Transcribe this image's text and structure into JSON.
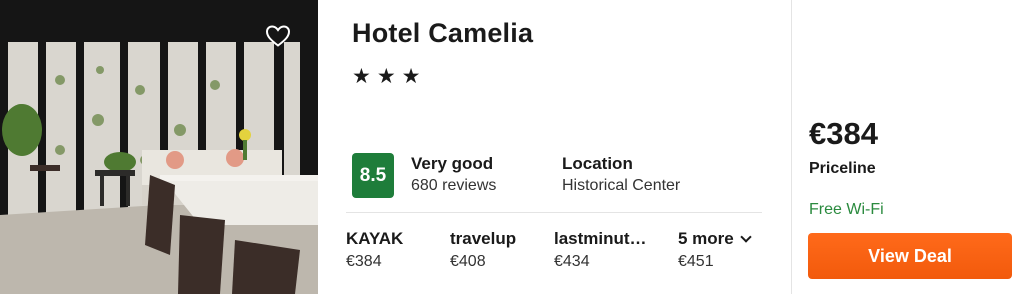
{
  "hotel": {
    "name": "Hotel Camelia",
    "stars_display": "★★★",
    "star_count": 3,
    "favorite_icon": "heart-outline-icon"
  },
  "rating": {
    "score": "8.5",
    "label": "Very good",
    "reviews": "680 reviews",
    "badge_color": "#1e7d3a"
  },
  "location": {
    "label": "Location",
    "value": "Historical Center"
  },
  "providers": [
    {
      "name": "KAYAK",
      "price": "€384"
    },
    {
      "name": "travelup",
      "price": "€408"
    },
    {
      "name": "lastminut…",
      "price": "€434"
    }
  ],
  "more": {
    "label": "5 more",
    "price": "€451",
    "icon": "chevron-down-icon"
  },
  "deal": {
    "price": "€384",
    "provider": "Priceline",
    "amenity": "Free Wi-Fi",
    "amenity_color": "#2a8a3e",
    "button_label": "View Deal",
    "button_color": "#f25a0c"
  }
}
